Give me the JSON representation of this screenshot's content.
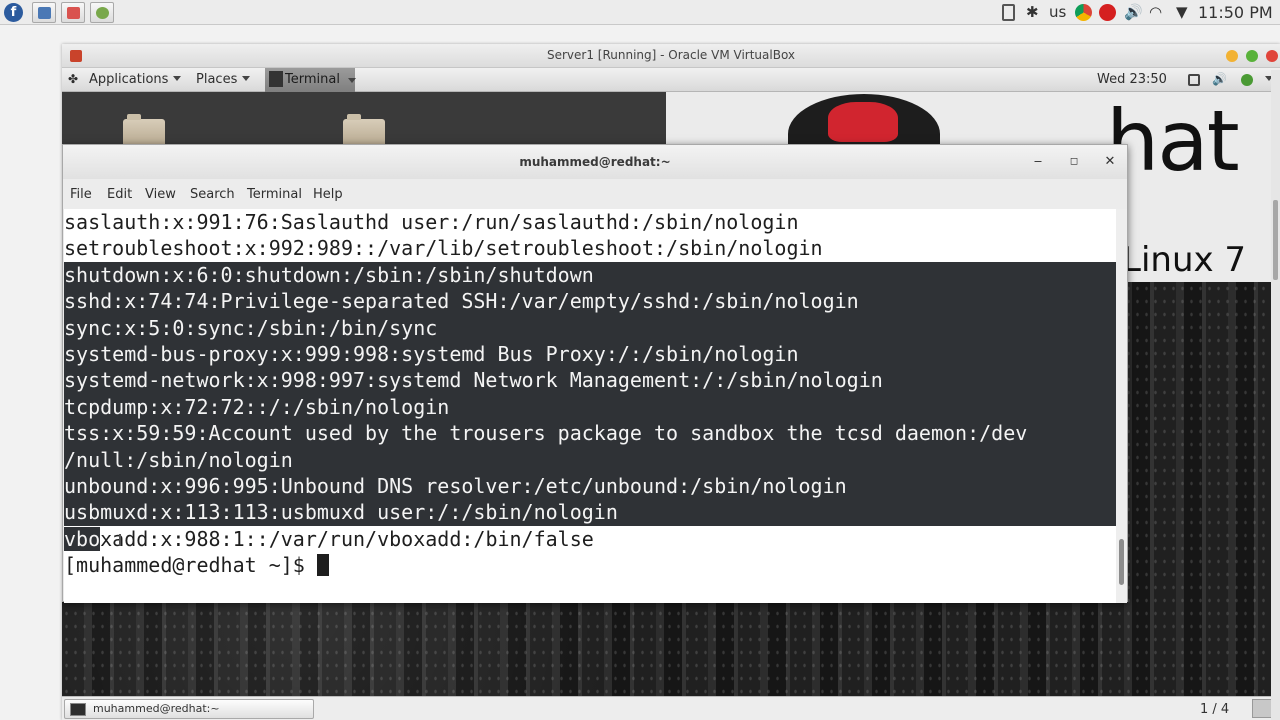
{
  "host_panel": {
    "launchers": [
      "fedora-icon",
      "window-icon",
      "image-viewer-icon",
      "app-icon"
    ],
    "keyboard_layout": "us",
    "clock": "11:50 PM"
  },
  "vbox": {
    "title": "Server1 [Running] - Oracle VM VirtualBox"
  },
  "guest_panel": {
    "applications": "Applications",
    "places": "Places",
    "terminal": "Terminal",
    "clock": "Wed 23:50"
  },
  "desktop": {
    "brand_text_1": "hat",
    "brand_text_2": "Linux 7"
  },
  "terminal": {
    "title": "muhammed@redhat:~",
    "menu": [
      "File",
      "Edit",
      "View",
      "Search",
      "Terminal",
      "Help"
    ],
    "lines": [
      "saslauth:x:991:76:Saslauthd user:/run/saslauthd:/sbin/nologin",
      "setroubleshoot:x:992:989::/var/lib/setroubleshoot:/sbin/nologin",
      "shutdown:x:6:0:shutdown:/sbin:/sbin/shutdown",
      "sshd:x:74:74:Privilege-separated SSH:/var/empty/sshd:/sbin/nologin",
      "sync:x:5:0:sync:/sbin:/bin/sync",
      "systemd-bus-proxy:x:999:998:systemd Bus Proxy:/:/sbin/nologin",
      "systemd-network:x:998:997:systemd Network Management:/:/sbin/nologin",
      "tcpdump:x:72:72::/:/sbin/nologin",
      "tss:x:59:59:Account used by the trousers package to sandbox the tcsd daemon:/dev",
      "/null:/sbin/nologin",
      "unbound:x:996:995:Unbound DNS resolver:/etc/unbound:/sbin/nologin",
      "usbmuxd:x:113:113:usbmuxd user:/:/sbin/nologin"
    ],
    "last_line_selected": "vbo",
    "last_line_rest": "xadd:x:988:1::/var/run/vboxadd:/bin/false",
    "prompt": "[muhammed@redhat ~]$ "
  },
  "guest_bottom": {
    "task": "muhammed@redhat:~",
    "workspace": "1 / 4"
  }
}
